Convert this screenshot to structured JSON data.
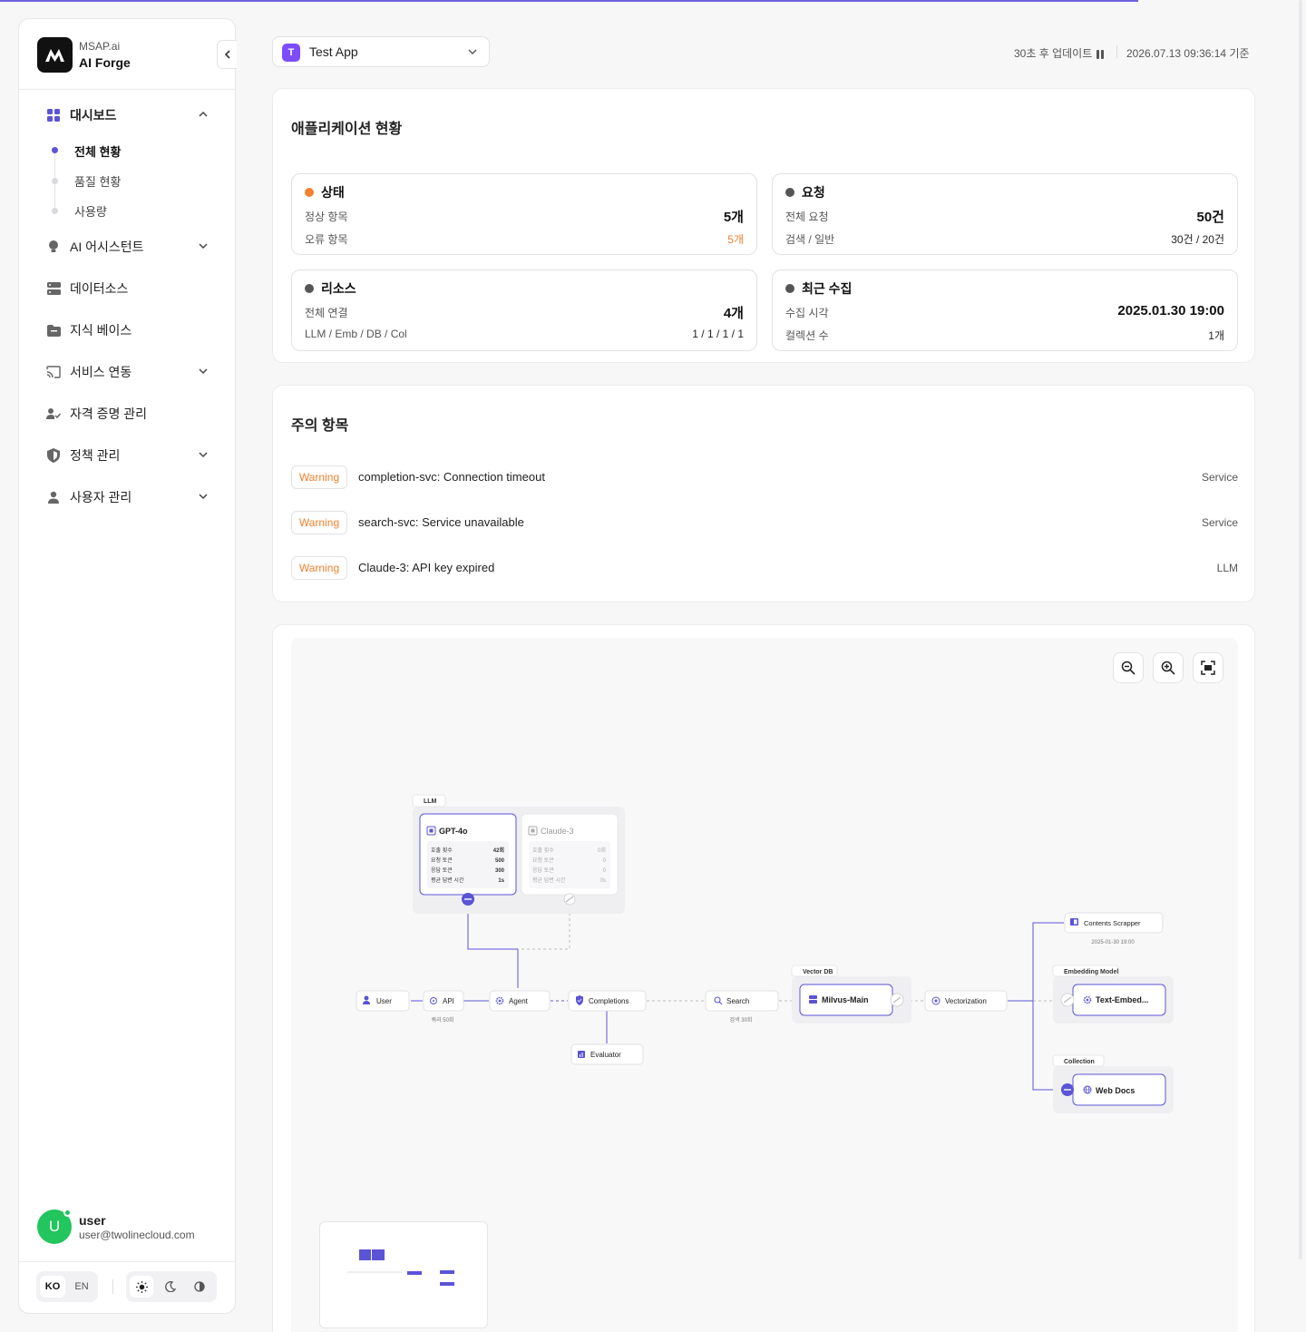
{
  "brand": {
    "sub": "MSAP.ai",
    "name": "AI Forge"
  },
  "nav": {
    "dashboard": "대시보드",
    "dashboard_items": [
      "전체 현황",
      "품질 현황",
      "사용량"
    ],
    "ai_assistant": "AI 어시스턴트",
    "datasource": "데이터소스",
    "knowledge": "지식 베이스",
    "service": "서비스 연동",
    "credential": "자격 증명 관리",
    "policy": "정책 관리",
    "user_mgmt": "사용자 관리"
  },
  "user": {
    "initial": "U",
    "name": "user",
    "email": "user@twolinecloud.com"
  },
  "lang": {
    "ko": "KO",
    "en": "EN"
  },
  "header": {
    "app_badge": "T",
    "app_name": "Test App",
    "update": "30초 후 업데이트",
    "timestamp": "2026.07.13 09:36:14 기준"
  },
  "status_panel": {
    "title": "애플리케이션 현황",
    "state": {
      "title": "상태",
      "l1": "정상 항목",
      "v1": "5개",
      "l2": "오류 항목",
      "v2": "5개"
    },
    "request": {
      "title": "요청",
      "l1": "전체 요청",
      "v1": "50건",
      "l2": "검색 / 일반",
      "v2": "30건 / 20건"
    },
    "resource": {
      "title": "리소스",
      "l1": "전체 연결",
      "v1": "4개",
      "l2": "LLM / Emb / DB / Col",
      "v2": "1 / 1 / 1 / 1"
    },
    "collect": {
      "title": "최근 수집",
      "l1": "수집 시각",
      "v1": "2025.01.30 19:00",
      "l2": "컬렉션 수",
      "v2": "1개"
    }
  },
  "warnings": {
    "title": "주의 항목",
    "items": [
      {
        "level": "Warning",
        "msg": "completion-svc: Connection timeout",
        "src": "Service"
      },
      {
        "level": "Warning",
        "msg": "search-svc: Service unavailable",
        "src": "Service"
      },
      {
        "level": "Warning",
        "msg": "Claude-3: API key expired",
        "src": "LLM"
      }
    ]
  },
  "flow": {
    "llm_group": "LLM",
    "gpt": {
      "name": "GPT-4o",
      "rows": [
        [
          "호출 횟수",
          "42회"
        ],
        [
          "요청 토큰",
          "500"
        ],
        [
          "응답 토큰",
          "300"
        ],
        [
          "평균 답변 시간",
          "1s"
        ]
      ]
    },
    "claude": {
      "name": "Claude-3",
      "rows": [
        [
          "호출 횟수",
          "0회"
        ],
        [
          "요청 토큰",
          "0"
        ],
        [
          "응답 토큰",
          "0"
        ],
        [
          "평균 답변 시간",
          "0s"
        ]
      ]
    },
    "user": "User",
    "api": "API",
    "api_sub": "쿼리 50회",
    "agent": "Agent",
    "completions": "Completions",
    "evaluator": "Evaluator",
    "search": "Search",
    "search_sub": "검색 30회",
    "vectordb_group": "Vector DB",
    "milvus": "Milvus-Main",
    "vectorization": "Vectorization",
    "scrapper": "Contents Scrapper",
    "scrapper_sub": "2025-01-30 19:00",
    "embedding_group": "Embedding Model",
    "embed": "Text-Embed...",
    "collection_group": "Collection",
    "webdocs": "Web Docs"
  },
  "colors": {
    "accent": "#5b54d6",
    "warning": "#f2812f",
    "online": "#22c55e"
  }
}
